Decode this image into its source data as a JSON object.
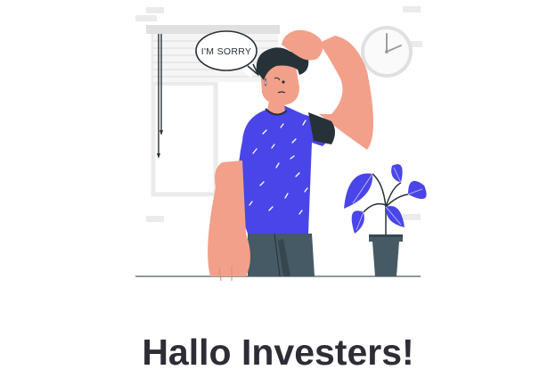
{
  "illustration": {
    "speech_bubble_text": "I'M SORRY",
    "colors": {
      "shirt": "#4a45e8",
      "skin": "#f2a08a",
      "hair": "#263238",
      "pants": "#455a64",
      "plant_leaf": "#4a45e8",
      "pot": "#455a64",
      "window": "#ebebeb"
    }
  },
  "headline": {
    "text": "Hallo Investers!"
  }
}
